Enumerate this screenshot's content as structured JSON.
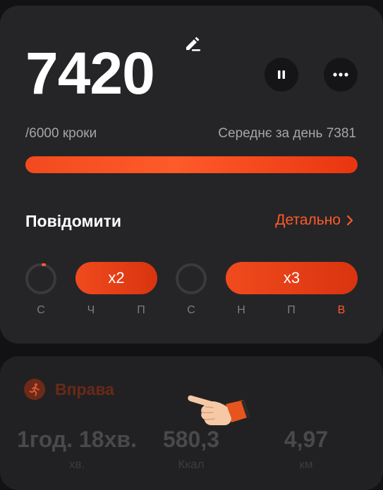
{
  "steps_card": {
    "steps": "7420",
    "goal": "/6000 кроки",
    "average": "Середнє за день 7381",
    "progress_percent": 100,
    "notify_title": "Повідомити",
    "details_label": "Детально",
    "week": {
      "badges": [
        "x2",
        "x3"
      ],
      "days": [
        "С",
        "Ч",
        "П",
        "С",
        "Н",
        "П",
        "В"
      ],
      "active_day_index": 6
    }
  },
  "exercise_card": {
    "title": "Вправа",
    "stats": [
      {
        "value": "1год. 18хв.",
        "unit": "хв."
      },
      {
        "value": "580,3",
        "unit": "Ккал"
      },
      {
        "value": "4,97",
        "unit": "км"
      }
    ]
  },
  "colors": {
    "accent": "#ff5a2a",
    "card_bg": "#252527",
    "page_bg": "#121214"
  },
  "icons": [
    "edit-icon",
    "pause-icon",
    "more-icon",
    "chevron-right-icon",
    "running-icon",
    "pointing-hand-icon"
  ]
}
